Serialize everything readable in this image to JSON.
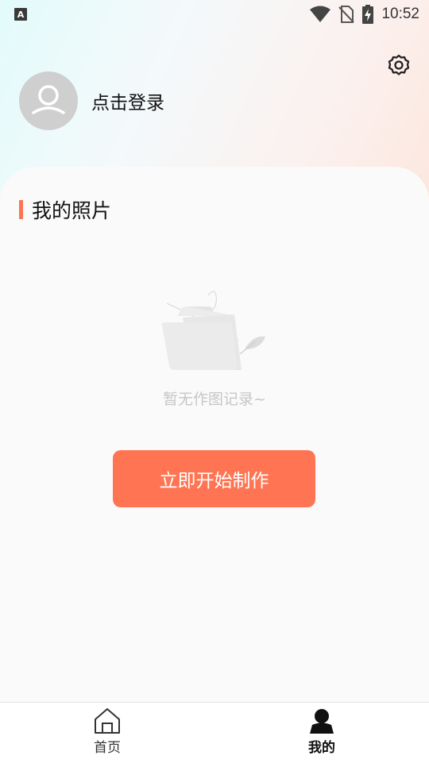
{
  "status_bar": {
    "app_icon_letter": "A",
    "time": "10:52",
    "icons": [
      "wifi-icon",
      "no-sim-icon",
      "battery-charging-icon"
    ]
  },
  "header": {
    "settings_icon": "gear-icon",
    "avatar_icon": "user-placeholder-icon",
    "login_label": "点击登录"
  },
  "photos_section": {
    "title": "我的照片",
    "empty_icon": "empty-folder-icon",
    "empty_text": "暂无作图记录~",
    "create_button_label": "立即开始制作"
  },
  "tabbar": {
    "items": [
      {
        "label": "首页",
        "icon": "home-icon",
        "active": false
      },
      {
        "label": "我的",
        "icon": "profile-icon",
        "active": true
      }
    ]
  },
  "colors": {
    "accent": "#ff7553",
    "empty_text": "#c6c6c6",
    "avatar_bg": "#cfcfcf"
  }
}
